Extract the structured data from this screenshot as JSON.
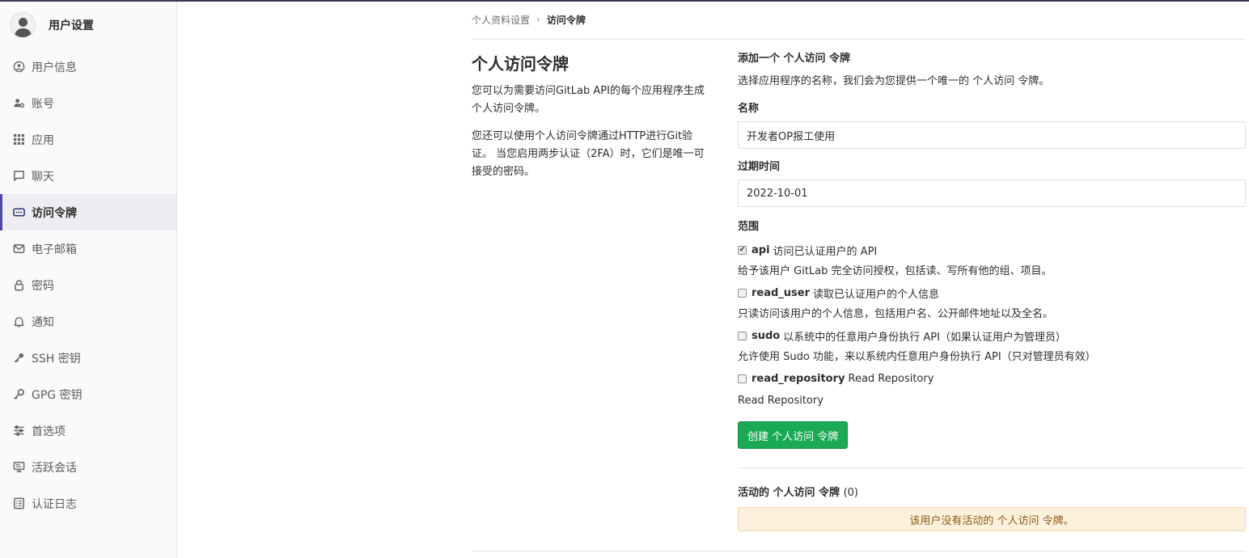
{
  "sidebar": {
    "title": "用户设置",
    "items": [
      {
        "label": "用户信息",
        "icon": "user-circle-icon"
      },
      {
        "label": "账号",
        "icon": "user-gear-icon"
      },
      {
        "label": "应用",
        "icon": "grid-icon"
      },
      {
        "label": "聊天",
        "icon": "chat-icon"
      },
      {
        "label": "访问令牌",
        "icon": "token-icon"
      },
      {
        "label": "电子邮箱",
        "icon": "mail-icon"
      },
      {
        "label": "密码",
        "icon": "lock-icon"
      },
      {
        "label": "通知",
        "icon": "bell-icon"
      },
      {
        "label": "SSH 密钥",
        "icon": "key-icon"
      },
      {
        "label": "GPG 密钥",
        "icon": "key-icon"
      },
      {
        "label": "首选项",
        "icon": "sliders-icon"
      },
      {
        "label": "活跃会话",
        "icon": "monitor-icon"
      },
      {
        "label": "认证日志",
        "icon": "list-icon"
      }
    ],
    "active_index": 4
  },
  "breadcrumb": {
    "parent": "个人资料设置",
    "separator": "›",
    "current": "访问令牌"
  },
  "intro": {
    "title": "个人访问令牌",
    "paragraph1": "您可以为需要访问GitLab API的每个应用程序生成个人访问令牌。",
    "paragraph2": "您还可以使用个人访问令牌通过HTTP进行Git验证。 当您启用两步认证（2FA）时，它们是唯一可接受的密码。"
  },
  "form": {
    "heading": "添加一个 个人访问 令牌",
    "subheading": "选择应用程序的名称，我们会为您提供一个唯一的 个人访问 令牌。",
    "name_label": "名称",
    "name_value": "开发者OP报工使用",
    "expires_label": "过期时间",
    "expires_value": "2022-10-01",
    "scopes_label": "范围",
    "scopes": [
      {
        "name": "api",
        "label": "访问已认证用户的 API",
        "help": "给予该用户 GitLab 完全访问授权，包括读、写所有他的组、项目。",
        "checked": true
      },
      {
        "name": "read_user",
        "label": "读取已认证用户的个人信息",
        "help": "只读访问该用户的个人信息，包括用户名、公开邮件地址以及全名。",
        "checked": false
      },
      {
        "name": "sudo",
        "label": "以系统中的任意用户身份执行 API（如果认证用户为管理员）",
        "help": "允许使用 Sudo 功能，来以系统内任意用户身份执行 API（只对管理员有效）",
        "checked": false
      },
      {
        "name": "read_repository",
        "label": "Read Repository",
        "help": "Read Repository",
        "checked": false
      }
    ],
    "submit_label": "创建 个人访问 令牌"
  },
  "active_tokens": {
    "title": "活动的 个人访问 令牌",
    "count": "(0)",
    "empty_message": "该用户没有活动的 个人访问 令牌。"
  },
  "colors": {
    "accent": "#4b4ba3",
    "success": "#1aaa55",
    "warning_bg": "#fdf1dd",
    "warning_text": "#8a5a14"
  }
}
